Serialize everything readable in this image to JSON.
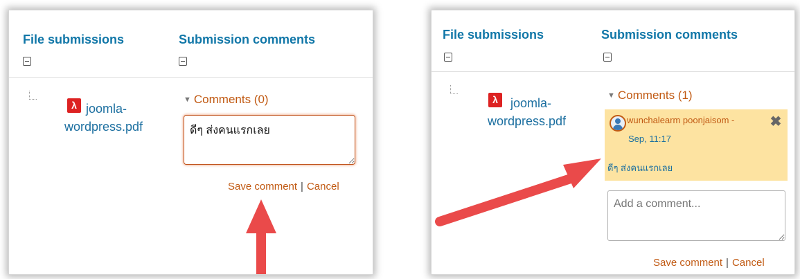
{
  "left_panel": {
    "header_files": "File submissions",
    "header_comments": "Submission comments",
    "file_name_line1": "joomla-",
    "file_name_line2": "wordpress.pdf",
    "comments_toggle": "Comments (0)",
    "textarea_value": "ดีๆ ส่งคนแรกเลย",
    "save_label": "Save comment",
    "separator": "|",
    "cancel_label": "Cancel"
  },
  "right_panel": {
    "header_files": "File submissions",
    "header_comments": "Submission comments",
    "file_name_line1": "joomla-",
    "file_name_line2": "wordpress.pdf",
    "comments_toggle": "Comments (1)",
    "comment": {
      "author": "wunchalearm poonjaisom -",
      "date": "Sep, 11:17",
      "text": "ดีๆ ส่งคนแรกเลย",
      "delete_icon": "close-icon"
    },
    "textarea_placeholder": "Add a comment...",
    "save_label": "Save comment",
    "separator": "|",
    "cancel_label": "Cancel"
  },
  "colors": {
    "header_blue": "#1177a8",
    "link_orange": "#c15a13",
    "comment_bg": "#fde3a1",
    "arrow_red": "#ea4a4a"
  }
}
